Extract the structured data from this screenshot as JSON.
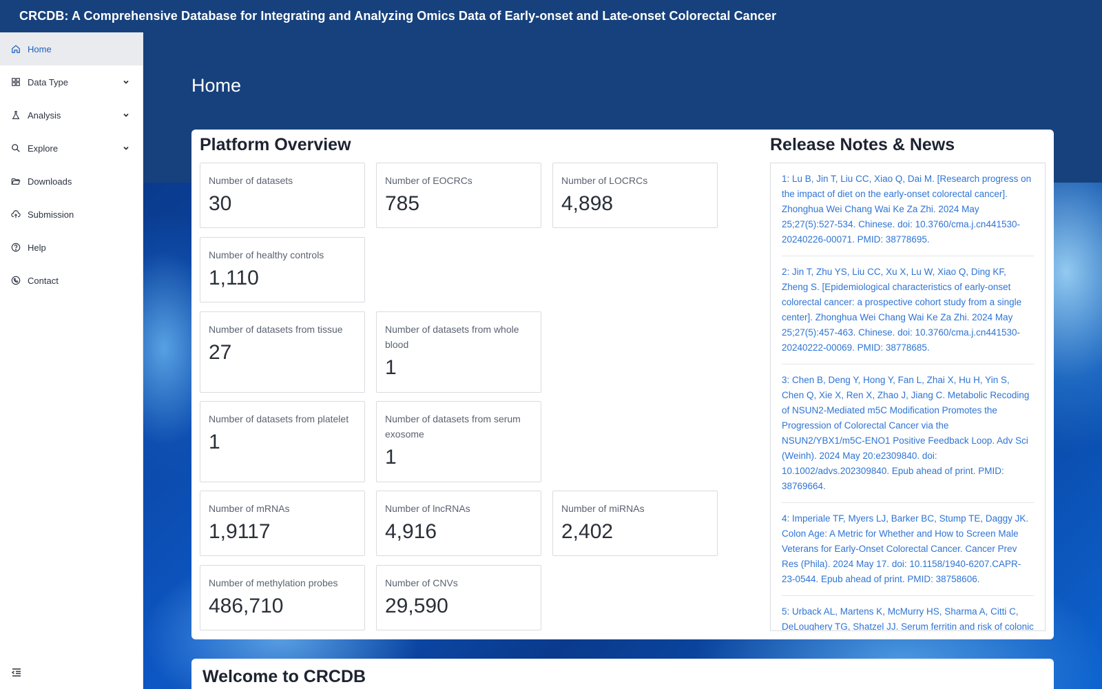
{
  "app": {
    "title": "CRCDB: A Comprehensive Database for Integrating and Analyzing Omics Data of Early-onset and Late-onset Colorectal Cancer"
  },
  "sidebar": {
    "items": [
      {
        "label": "Home",
        "icon": "home-icon",
        "active": true,
        "has_submenu": false
      },
      {
        "label": "Data Type",
        "icon": "grid-icon",
        "active": false,
        "has_submenu": true
      },
      {
        "label": "Analysis",
        "icon": "flask-icon",
        "active": false,
        "has_submenu": true
      },
      {
        "label": "Explore",
        "icon": "search-icon",
        "active": false,
        "has_submenu": true
      },
      {
        "label": "Downloads",
        "icon": "folder-open-icon",
        "active": false,
        "has_submenu": false
      },
      {
        "label": "Submission",
        "icon": "cloud-upload-icon",
        "active": false,
        "has_submenu": false
      },
      {
        "label": "Help",
        "icon": "help-circle-icon",
        "active": false,
        "has_submenu": false
      },
      {
        "label": "Contact",
        "icon": "phone-icon",
        "active": false,
        "has_submenu": false
      }
    ],
    "collapse_icon": "menu-collapse-icon"
  },
  "page": {
    "title": "Home"
  },
  "overview": {
    "title": "Platform Overview",
    "stats": [
      {
        "label": "Number of datasets",
        "value": "30"
      },
      {
        "label": "Number of EOCRCs",
        "value": "785"
      },
      {
        "label": "Number of LOCRCs",
        "value": "4,898"
      },
      {
        "label": "Number of healthy controls",
        "value": "1,110"
      },
      {
        "label": "Number of datasets from tissue",
        "value": "27"
      },
      {
        "label": "Number of datasets from whole blood",
        "value": "1"
      },
      {
        "label": "Number of datasets from platelet",
        "value": "1"
      },
      {
        "label": "Number of datasets from serum exosome",
        "value": "1"
      },
      {
        "label": "Number of mRNAs",
        "value": "1,9117"
      },
      {
        "label": "Number of lncRNAs",
        "value": "4,916"
      },
      {
        "label": "Number of miRNAs",
        "value": "2,402"
      },
      {
        "label": "Number of methylation probes",
        "value": "486,710"
      },
      {
        "label": "Number of CNVs",
        "value": "29,590"
      }
    ]
  },
  "news": {
    "title": "Release Notes & News",
    "items": [
      "1: Lu B, Jin T, Liu CC, Xiao Q, Dai M. [Research progress on the impact of diet on the early-onset colorectal cancer]. Zhonghua Wei Chang Wai Ke Za Zhi. 2024 May 25;27(5):527-534. Chinese. doi: 10.3760/cma.j.cn441530-20240226-00071. PMID: 38778695.",
      "2: Jin T, Zhu YS, Liu CC, Xu X, Lu W, Xiao Q, Ding KF, Zheng S. [Epidemiological characteristics of early-onset colorectal cancer: a prospective cohort study from a single center]. Zhonghua Wei Chang Wai Ke Za Zhi. 2024 May 25;27(5):457-463. Chinese. doi: 10.3760/cma.j.cn441530-20240222-00069. PMID: 38778685.",
      "3: Chen B, Deng Y, Hong Y, Fan L, Zhai X, Hu H, Yin S, Chen Q, Xie X, Ren X, Zhao J, Jiang C. Metabolic Recoding of NSUN2-Mediated m5C Modification Promotes the Progression of Colorectal Cancer via the NSUN2/YBX1/m5C-ENO1 Positive Feedback Loop. Adv Sci (Weinh). 2024 May 20:e2309840. doi: 10.1002/advs.202309840. Epub ahead of print. PMID: 38769664.",
      "4: Imperiale TF, Myers LJ, Barker BC, Stump TE, Daggy JK. Colon Age: A Metric for Whether and How to Screen Male Veterans for Early-Onset Colorectal Cancer. Cancer Prev Res (Phila). 2024 May 17. doi: 10.1158/1940-6207.CAPR-23-0544. Epub ahead of print. PMID: 38758606.",
      "5: Urback AL, Martens K, McMurry HS, Sharma A, Citti C, DeLoughery TG, Shatzel JJ. Serum ferritin and risk of colonic"
    ]
  },
  "welcome": {
    "title": "Welcome to CRCDB"
  },
  "colors": {
    "header_bg": "#17417c",
    "accent": "#1f5fbf",
    "link": "#2e74d4"
  }
}
